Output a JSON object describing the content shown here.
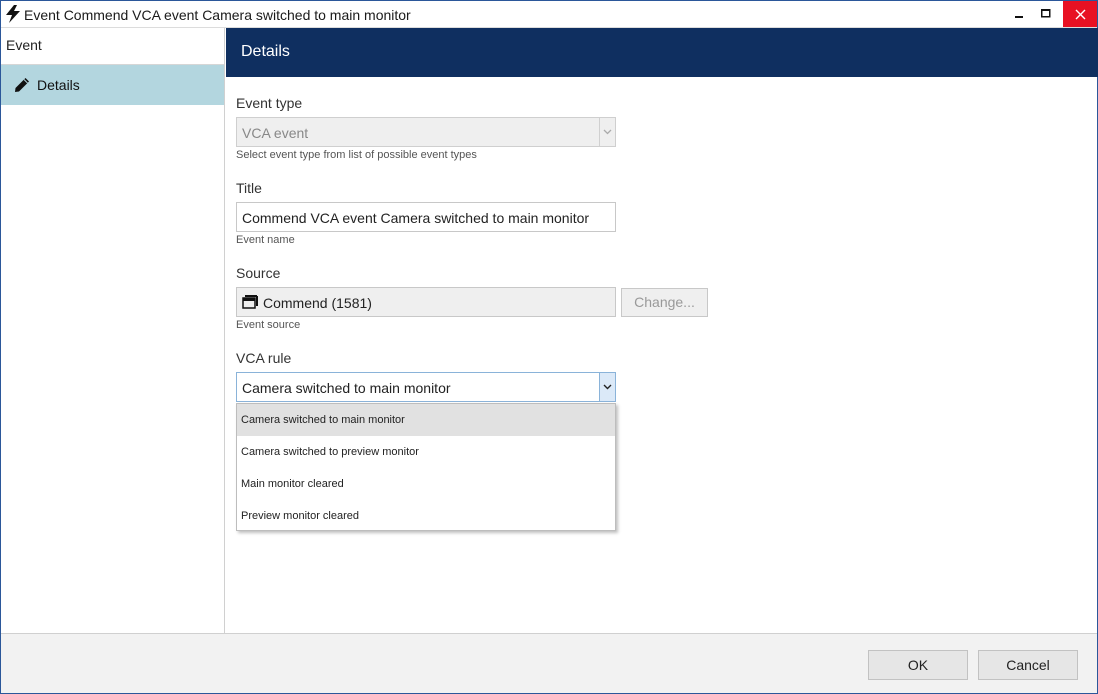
{
  "window": {
    "title": "Event Commend VCA event Camera switched to main monitor"
  },
  "sidebar": {
    "header": "Event",
    "items": [
      {
        "label": "Details",
        "icon": "pencil-icon",
        "selected": true
      }
    ]
  },
  "main": {
    "header": "Details",
    "event_type": {
      "label": "Event type",
      "value": "VCA event",
      "hint": "Select event type from list of possible event types"
    },
    "title_field": {
      "label": "Title",
      "value": "Commend VCA event Camera switched to main monitor",
      "hint": "Event name"
    },
    "source": {
      "label": "Source",
      "value": "Commend (1581)",
      "hint": "Event source",
      "change_label": "Change..."
    },
    "vca_rule": {
      "label": "VCA rule",
      "value": "Camera switched to main monitor",
      "options": [
        "Camera switched to main monitor",
        "Camera switched to preview monitor",
        "Main monitor cleared",
        "Preview monitor cleared"
      ]
    }
  },
  "footer": {
    "ok_label": "OK",
    "cancel_label": "Cancel"
  },
  "colors": {
    "header_bg": "#0f2f60",
    "nav_selected_bg": "#b3d6df",
    "close_button_bg": "#e81123"
  }
}
